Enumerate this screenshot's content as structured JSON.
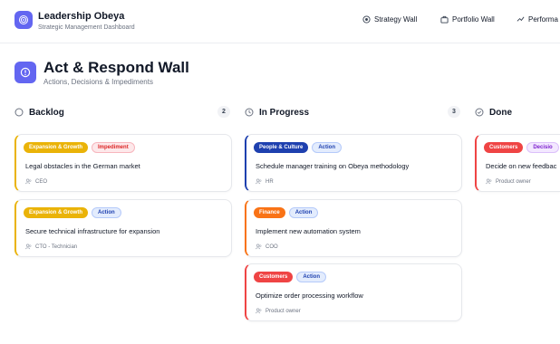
{
  "header": {
    "app_title": "Leadership Obeya",
    "app_subtitle": "Strategic Management Dashboard",
    "nav": [
      {
        "label": "Strategy Wall",
        "icon": "target-icon"
      },
      {
        "label": "Portfolio Wall",
        "icon": "briefcase-icon"
      },
      {
        "label": "Performa",
        "icon": "trend-icon"
      }
    ]
  },
  "page": {
    "title": "Act & Respond Wall",
    "subtitle": "Actions, Decisions & Impediments",
    "icon": "alert-circle-icon"
  },
  "colors": {
    "accent": "#6366f1",
    "expansion": "#eab308",
    "people": "#1e40af",
    "finance": "#f97316",
    "customers": "#ef4444"
  },
  "columns": [
    {
      "title": "Backlog",
      "count": "2",
      "icon": "circle-icon",
      "cards": [
        {
          "category": "Expansion & Growth",
          "type": "Impediment",
          "title": "Legal obstacles in the German market",
          "owner": "CEO"
        },
        {
          "category": "Expansion & Growth",
          "type": "Action",
          "title": "Secure technical infrastructure for expansion",
          "owner": "CTO - Technician"
        }
      ]
    },
    {
      "title": "In Progress",
      "count": "3",
      "icon": "clock-icon",
      "cards": [
        {
          "category": "People & Culture",
          "type": "Action",
          "title": "Schedule manager training on Obeya methodology",
          "owner": "HR"
        },
        {
          "category": "Finance",
          "type": "Action",
          "title": "Implement new automation system",
          "owner": "COO"
        },
        {
          "category": "Customers",
          "type": "Action",
          "title": "Optimize order processing workflow",
          "owner": "Product owner"
        }
      ]
    },
    {
      "title": "Done",
      "icon": "check-circle-icon",
      "cards": [
        {
          "category": "Customers",
          "type": "Decisio",
          "title": "Decide on new feedbac",
          "owner": "Product owner"
        }
      ]
    }
  ]
}
